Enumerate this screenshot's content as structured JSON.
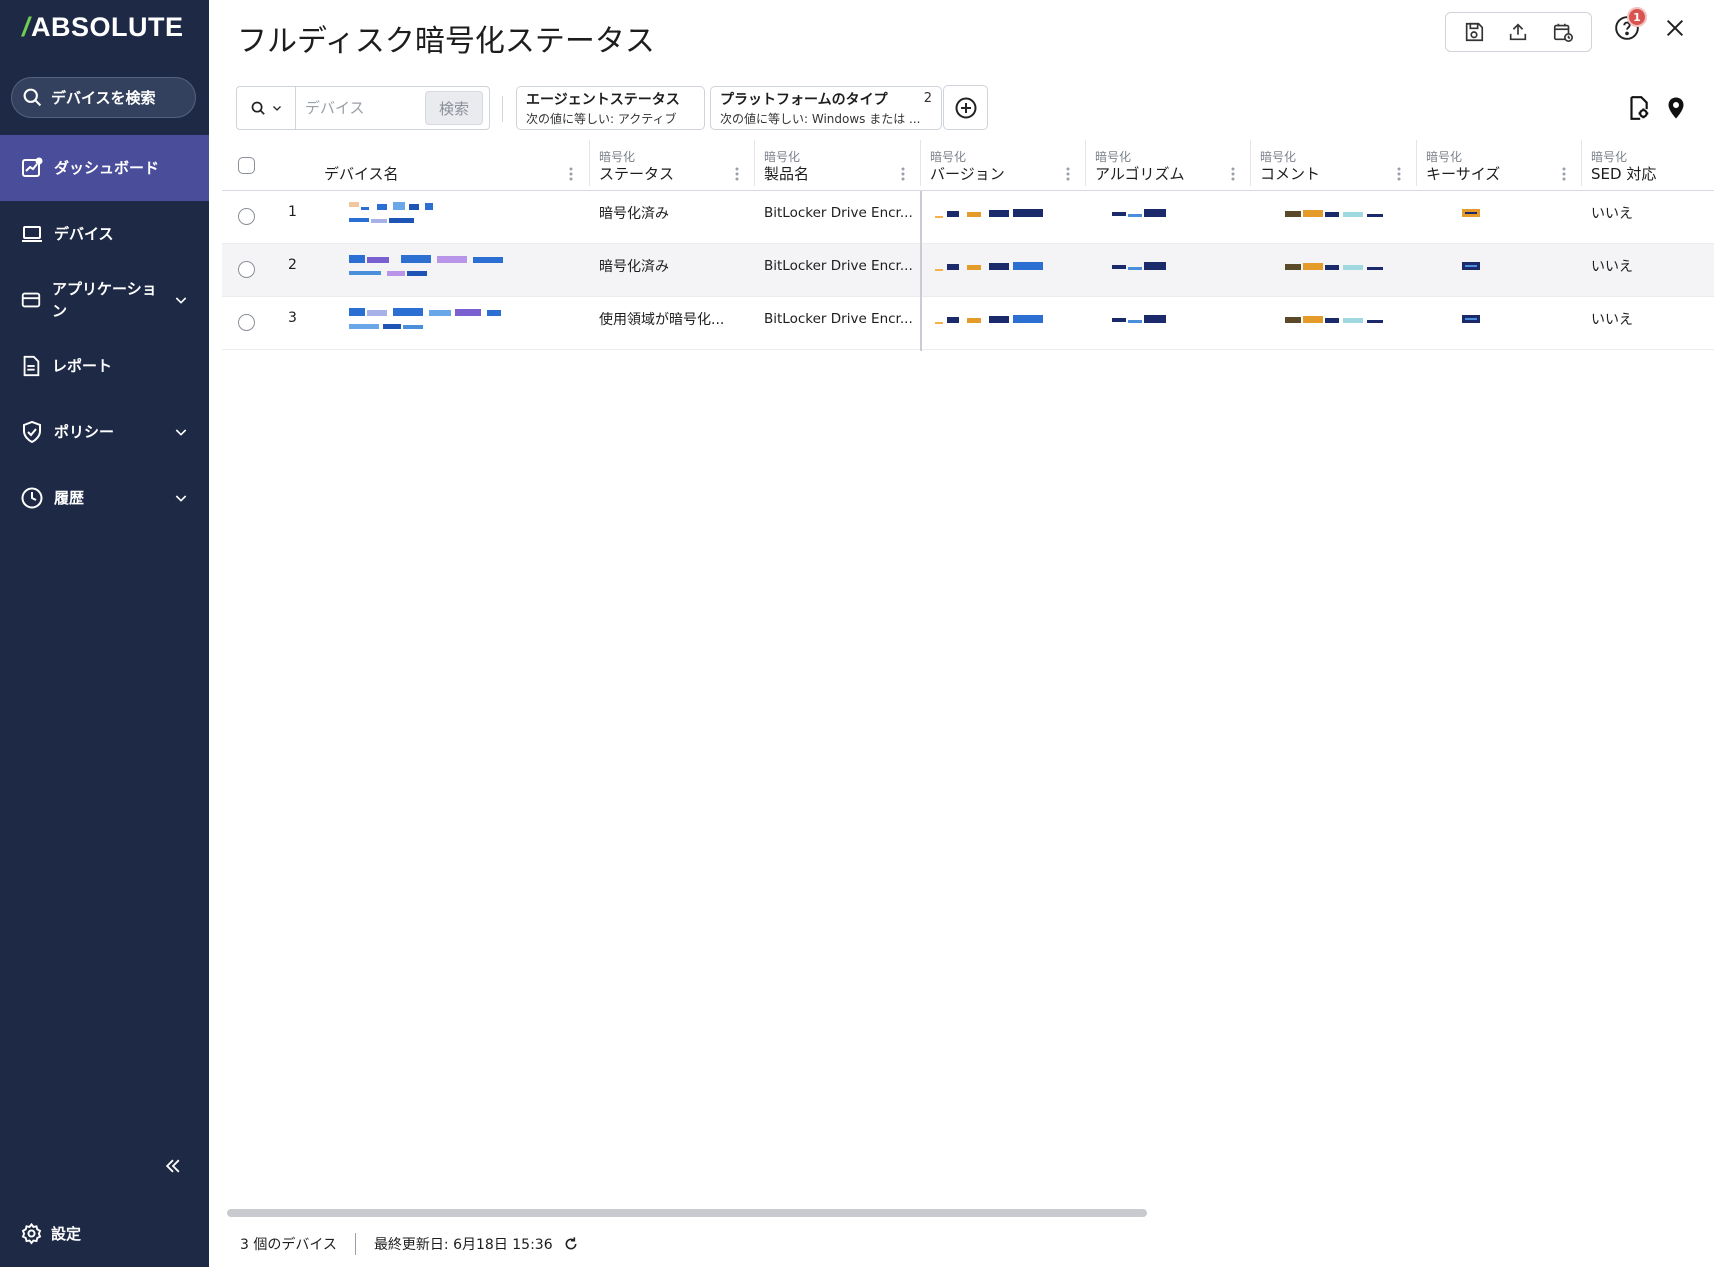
{
  "sidebar": {
    "logo": "ABSOLUTE",
    "search_label": "デバイスを検索",
    "items": [
      {
        "label": "ダッシュボード",
        "active": true
      },
      {
        "label": "デバイス",
        "active": false
      },
      {
        "label": "アプリケーション",
        "active": false,
        "expandable": true
      },
      {
        "label": "レポート",
        "active": false
      },
      {
        "label": "ポリシー",
        "active": false,
        "expandable": true
      },
      {
        "label": "履歴",
        "active": false,
        "expandable": true
      }
    ],
    "settings_label": "設定"
  },
  "header": {
    "title": "フルディスク暗号化ステータス",
    "help_badge": "1"
  },
  "filters": {
    "search_placeholder": "デバイス",
    "search_button": "検索",
    "chips": [
      {
        "title": "エージェントステータス",
        "subtitle": "次の値に等しい: アクティブ",
        "count": ""
      },
      {
        "title": "プラットフォームのタイプ",
        "subtitle": "次の値に等しい: Windows または ...",
        "count": "2"
      }
    ]
  },
  "table": {
    "columns": [
      {
        "prefix": "",
        "label": "デバイス名"
      },
      {
        "prefix": "暗号化",
        "label": "ステータス"
      },
      {
        "prefix": "暗号化",
        "label": "製品名"
      },
      {
        "prefix": "暗号化",
        "label": "バージョン"
      },
      {
        "prefix": "暗号化",
        "label": "アルゴリズム"
      },
      {
        "prefix": "暗号化",
        "label": "コメント"
      },
      {
        "prefix": "暗号化",
        "label": "キーサイズ"
      },
      {
        "prefix": "暗号化",
        "label": "SED 対応"
      }
    ],
    "rows": [
      {
        "num": "1",
        "status": "暗号化済み",
        "product": "BitLocker Drive Encr...",
        "sed": "いいえ"
      },
      {
        "num": "2",
        "status": "暗号化済み",
        "product": "BitLocker Drive Encr...",
        "sed": "いいえ"
      },
      {
        "num": "3",
        "status": "使用領域が暗号化...",
        "product": "BitLocker Drive Encr...",
        "sed": "いいえ"
      }
    ]
  },
  "footer": {
    "device_count": "3 個のデバイス",
    "last_updated": "最終更新日: 6月18日 15:36"
  },
  "colors": {
    "sidebar_bg": "#1e2a45",
    "active_nav": "#4a4d9a",
    "logo_accent": "#6fcf4f",
    "badge": "#d9534f"
  }
}
